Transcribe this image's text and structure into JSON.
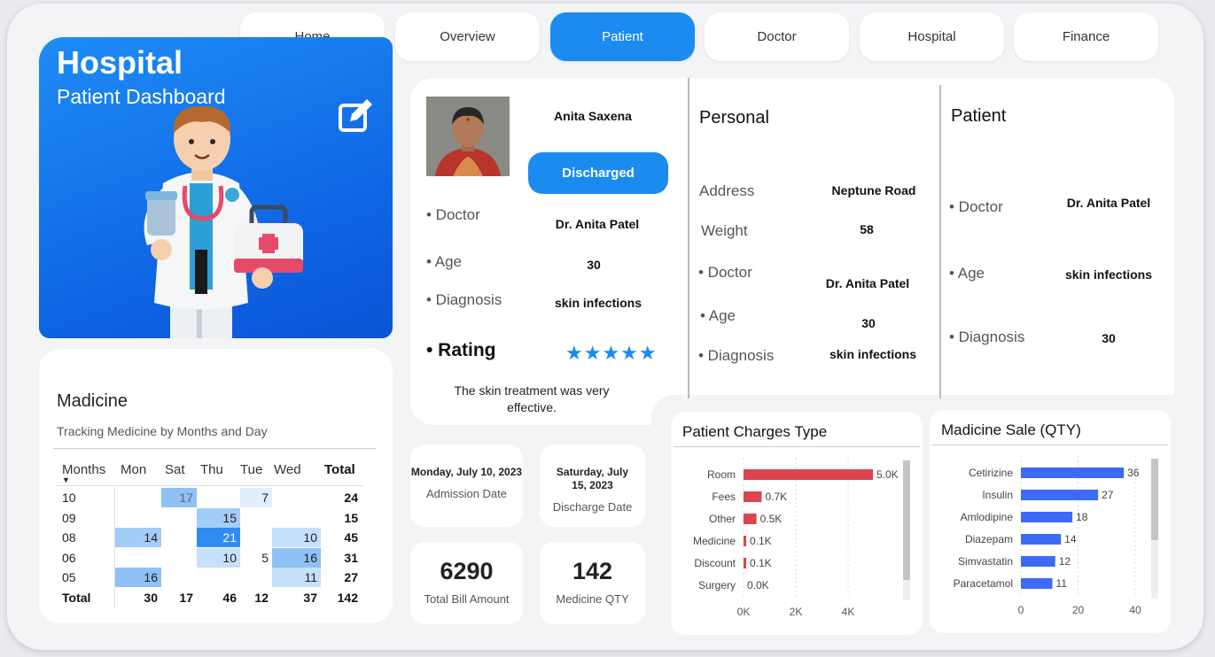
{
  "nav": [
    {
      "label": "Home",
      "active": false
    },
    {
      "label": "Overview",
      "active": false
    },
    {
      "label": "Patient",
      "active": true
    },
    {
      "label": "Doctor",
      "active": false
    },
    {
      "label": "Hospital",
      "active": false
    },
    {
      "label": "Finance",
      "active": false
    }
  ],
  "hero": {
    "title": "Hospital",
    "subtitle": "Patient Dashboard"
  },
  "medicine": {
    "title": "Madicine",
    "subtitle": "Tracking Medicine by Months and Day",
    "headers": [
      "Months",
      "Mon",
      "Sat",
      "Thu",
      "Tue",
      "Wed",
      "Total"
    ],
    "rows": [
      {
        "month": "10",
        "cells": [
          "",
          "17",
          "",
          "7",
          ""
        ],
        "total": "24"
      },
      {
        "month": "09",
        "cells": [
          "",
          "",
          "15",
          "",
          ""
        ],
        "total": "15"
      },
      {
        "month": "08",
        "cells": [
          "14",
          "",
          "21",
          "",
          "10"
        ],
        "total": "45"
      },
      {
        "month": "06",
        "cells": [
          "",
          "",
          "10",
          "5",
          "16"
        ],
        "total": "31"
      },
      {
        "month": "05",
        "cells": [
          "16",
          "",
          "",
          "",
          "11"
        ],
        "total": "27"
      }
    ],
    "total_row": {
      "label": "Total",
      "cells": [
        "30",
        "17",
        "46",
        "12",
        "37"
      ],
      "total": "142"
    }
  },
  "profile": {
    "name": "Anita Saxena",
    "status": "Discharged",
    "doctor_label": "• Doctor",
    "doctor": "Dr. Anita Patel",
    "age_label": "• Age",
    "age": "30",
    "diagnosis_label": "• Diagnosis",
    "diagnosis": "skin infections",
    "rating_label": "• Rating",
    "stars": "★★★★★",
    "review": "The skin treatment was very effective."
  },
  "personal": {
    "title": "Personal",
    "address_label": "Address",
    "address": "Neptune Road",
    "weight_label": "Weight",
    "weight": "58",
    "doctor_label": "• Doctor",
    "doctor": "Dr. Anita Patel",
    "age_label": "• Age",
    "age": "30",
    "diagnosis_label": "• Diagnosis",
    "diagnosis": "skin infections"
  },
  "patient": {
    "title": "Patient",
    "doctor_label": "• Doctor",
    "doctor": "Dr. Anita Patel",
    "age_label": "• Age",
    "age": "skin infections",
    "diagnosis_label": "• Diagnosis",
    "diagnosis": "30"
  },
  "dates": {
    "admission": "Monday, July 10, 2023",
    "admission_label": "Admission Date",
    "discharge": "Saturday, July 15, 2023",
    "discharge_label": "Discharge Date"
  },
  "kpis": {
    "bill": "6290",
    "bill_label": "Total Bill Amount",
    "qty": "142",
    "qty_label": "Medicine QTY"
  },
  "colors": {
    "accent": "#1b8bf0",
    "bar_red": "#dc4450",
    "bar_blue": "#3b6bf5"
  },
  "chart_data": [
    {
      "type": "bar",
      "orientation": "horizontal",
      "title": "Patient Charges Type",
      "categories": [
        "Room",
        "Fees",
        "Other",
        "Medicine",
        "Discount",
        "Surgery"
      ],
      "values": [
        5000,
        700,
        500,
        100,
        100,
        0
      ],
      "labels": [
        "5.0K",
        "0.7K",
        "0.5K",
        "0.1K",
        "0.1K",
        "0.0K"
      ],
      "xticks": [
        "0K",
        "2K",
        "4K"
      ],
      "xlim": [
        0,
        5000
      ],
      "color": "#dc4450"
    },
    {
      "type": "bar",
      "orientation": "horizontal",
      "title": "Madicine Sale (QTY)",
      "categories": [
        "Cetirizine",
        "Insulin",
        "Amlodipine",
        "Diazepam",
        "Simvastatin",
        "Paracetamol"
      ],
      "values": [
        36,
        27,
        18,
        14,
        12,
        11
      ],
      "labels": [
        "36",
        "27",
        "18",
        "14",
        "12",
        "11"
      ],
      "xticks": [
        "0",
        "20",
        "40"
      ],
      "xlim": [
        0,
        40
      ],
      "color": "#3b6bf5"
    }
  ]
}
